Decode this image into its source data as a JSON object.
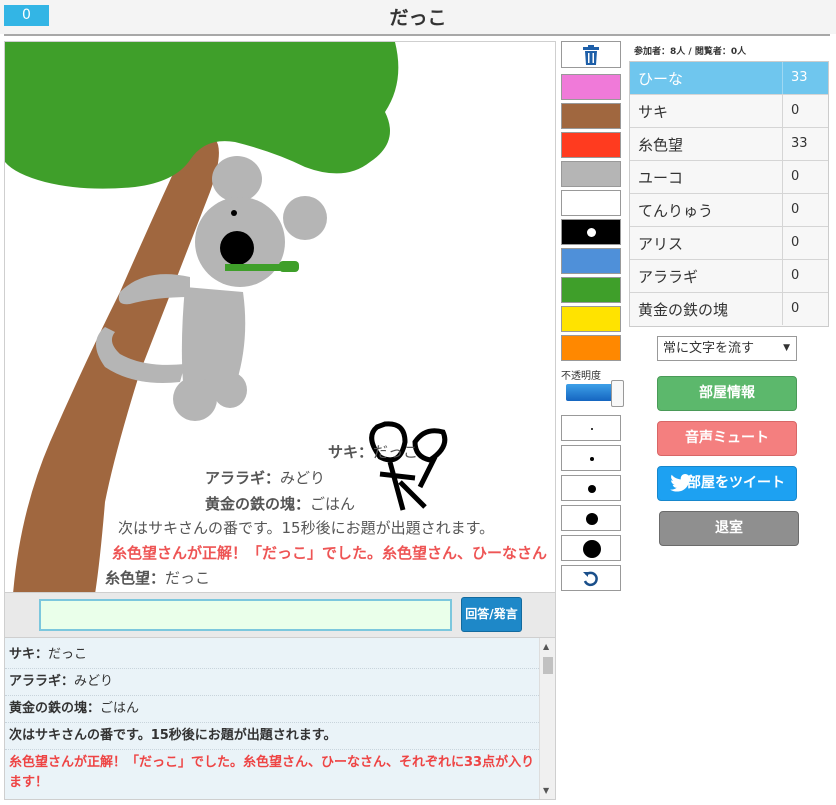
{
  "header": {
    "counter": "0",
    "title": "だっこ"
  },
  "overlay": {
    "lines": [
      {
        "name": "サキ",
        "sep": "：",
        "text": "だっこ"
      },
      {
        "name": "アララギ",
        "sep": "：",
        "text": "みどり"
      },
      {
        "name": "黄金の鉄の塊",
        "sep": "：",
        "text": "ごはん"
      },
      {
        "text": "次はサキさんの番です。15秒後にお題が出題されます。"
      },
      {
        "text": "糸色望さんが正解！「だっこ」でした。糸色望さん、ひーなさん"
      },
      {
        "name": "糸色望",
        "sep": "：",
        "text": "だっこ"
      }
    ]
  },
  "input": {
    "value": "",
    "submit_label": "回答/発言"
  },
  "log": {
    "rows": [
      {
        "name": "サキ",
        "sep": "：",
        "text": "だっこ"
      },
      {
        "name": "アララギ",
        "sep": "：",
        "text": "みどり"
      },
      {
        "name": "黄金の鉄の塊",
        "sep": "：",
        "text": "ごはん"
      },
      {
        "text": "次はサキさんの番です。15秒後にお題が出題されます。"
      },
      {
        "text": "糸色望さんが正解！「だっこ」でした。糸色望さん、ひーなさん、それぞれに33点が入ります！"
      }
    ]
  },
  "tools": {
    "trash_icon": "trash-icon",
    "colors": [
      "#f07ad9",
      "#a0673f",
      "#ff3b1f",
      "#b5b5b5",
      "#ffffff",
      "#000000",
      "#4f90d9",
      "#3f9f2a",
      "#ffe300",
      "#ff8800"
    ],
    "opacity_label": "不透明度",
    "opacity_value": 1.0,
    "undo_icon": "undo-icon"
  },
  "participants": {
    "counts_label": "参加者：8人 / 閲覧者：0人",
    "players": [
      {
        "name": "ひーな",
        "score": "33",
        "active": true
      },
      {
        "name": "サキ",
        "score": "0"
      },
      {
        "name": "糸色望",
        "score": "33"
      },
      {
        "name": "ユーコ",
        "score": "0"
      },
      {
        "name": "てんりゅう",
        "score": "0"
      },
      {
        "name": "アリス",
        "score": "0"
      },
      {
        "name": "アララギ",
        "score": "0"
      },
      {
        "name": "黄金の鉄の塊",
        "score": "0"
      }
    ]
  },
  "controls": {
    "scroll_select": "常に文字を流す",
    "room_info": "部屋情報",
    "mute": "音声ミュート",
    "tweet": "部屋をツイート",
    "leave": "退室"
  },
  "colors": {
    "accent": "#33b5e5",
    "active_player": "#6fc6ee",
    "room_info": "#5cb86c",
    "mute": "#f47f7f",
    "tweet": "#1da1f2",
    "leave": "#8f8f8f"
  }
}
